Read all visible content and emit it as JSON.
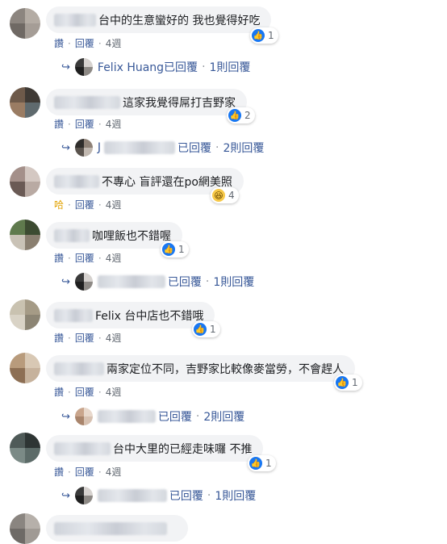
{
  "comments": [
    {
      "text": "台中的生意蠻好的 我也覺得好吃",
      "react_icon": "like-icon",
      "react_count": "1",
      "actions": [
        "讚",
        "回覆",
        "4週"
      ],
      "reply": {
        "author": "Felix Huang已回覆",
        "count": "1則回覆"
      }
    },
    {
      "text": "這家我覺得屌打吉野家",
      "react_icon": "like-icon",
      "react_count": "2",
      "actions": [
        "讚",
        "回覆",
        "4週"
      ],
      "reply": {
        "initial": "J",
        "suffix": "已回覆",
        "count": "2則回覆"
      }
    },
    {
      "text": "不專心 盲評還在po網美照",
      "react_icon": "haha-icon",
      "react_count": "4",
      "actions": [
        "哈",
        "回覆",
        "4週"
      ]
    },
    {
      "text": "咖哩飯也不錯喔",
      "react_icon": "like-icon",
      "react_count": "1",
      "actions": [
        "讚",
        "回覆",
        "4週"
      ],
      "reply": {
        "suffix": "已回覆",
        "count": "1則回覆"
      }
    },
    {
      "text": "Felix 台中店也不錯哦",
      "react_icon": "like-icon",
      "react_count": "1",
      "actions": [
        "讚",
        "回覆",
        "4週"
      ]
    },
    {
      "text": "兩家定位不同，吉野家比較像麥當勞，不會趕人",
      "react_icon": "like-icon",
      "react_count": "1",
      "actions": [
        "讚",
        "回覆",
        "4週"
      ],
      "reply": {
        "suffix": "已回覆",
        "count": "2則回覆"
      }
    },
    {
      "text": "台中大里的已經走味囉 不推",
      "react_icon": "like-icon",
      "react_count": "1",
      "actions": [
        "讚",
        "回覆",
        "4週"
      ],
      "reply": {
        "suffix": "已回覆",
        "count": "1則回覆"
      }
    }
  ],
  "colors": {
    "bubble_bg": "#f2f3f5",
    "link_blue": "#385898",
    "like_blue": "#1877f2",
    "muted": "#606770"
  }
}
